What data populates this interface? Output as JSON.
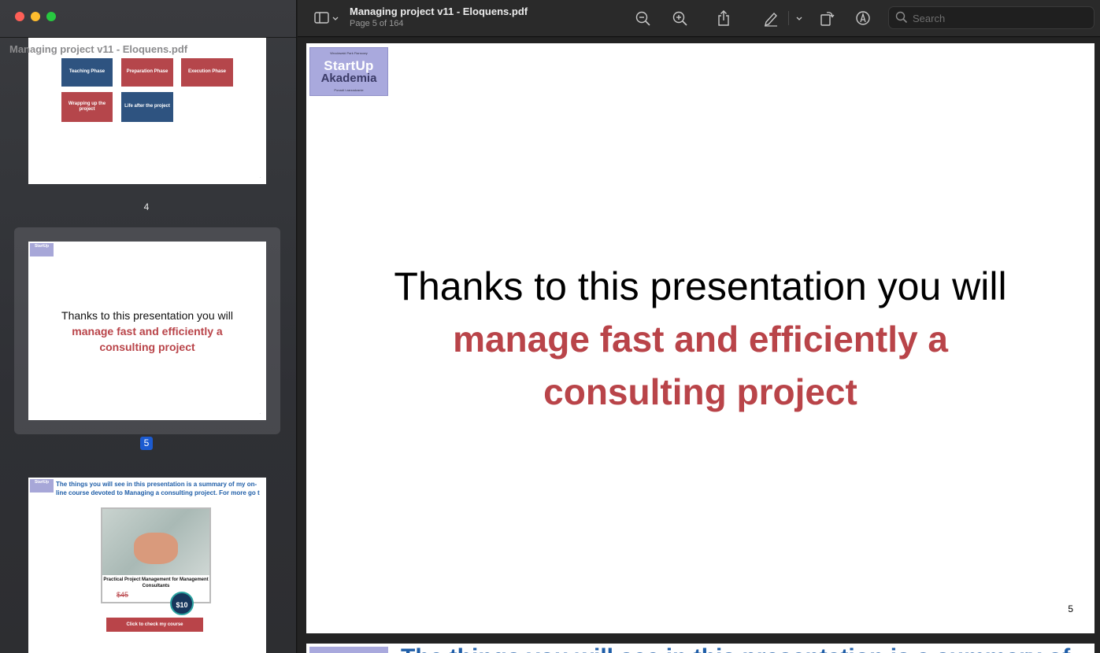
{
  "window": {
    "title": "Managing project v11 - Eloquens.pdf",
    "subtitle": "Page 5 of 164"
  },
  "sidebar": {
    "title": "Managing project v11 - Eloquens.pdf",
    "thumbnails": {
      "page4": {
        "number": "4",
        "boxes": [
          "Teaching Phase",
          "Preparation Phase",
          "Execution Phase",
          "Wrapping up the project",
          "Life after the project"
        ]
      },
      "page5": {
        "number": "5",
        "line1": "Thanks to this presentation you will",
        "line2": "manage fast and efficiently a",
        "line3": "consulting project",
        "logo": "StartUp"
      },
      "page6": {
        "heading": "The things you will see in this presentation is a summary of my on-line course devoted to Managing a consulting project. For more go t",
        "caption": "Practical Project Management for Management Consultants",
        "old_price": "$45",
        "price": "$10",
        "button": "Click to check my course",
        "logo": "StartUp"
      }
    }
  },
  "toolbar": {
    "icons": [
      "sidebar-icon",
      "zoom-out-icon",
      "zoom-in-icon",
      "share-icon",
      "markup-icon",
      "rotate-icon",
      "annotate-icon",
      "search-icon"
    ],
    "search_placeholder": "Search"
  },
  "document": {
    "logo_top": "Wroclawski Park Fiansowy",
    "logo_line1": "StartUp",
    "logo_line2": "Akademia",
    "logo_bottom": "Ponadi i zarzadzanie",
    "line1": "Thanks to this presentation you will",
    "line2": "manage fast and efficiently a",
    "line3": "consulting project",
    "page_number": "5",
    "next_page_heading": "The things you will see in this presentation is a summary of"
  },
  "colors": {
    "accent_red": "#b94449",
    "selection_blue": "#1c5bd0",
    "heading_blue": "#1f5ea8"
  }
}
